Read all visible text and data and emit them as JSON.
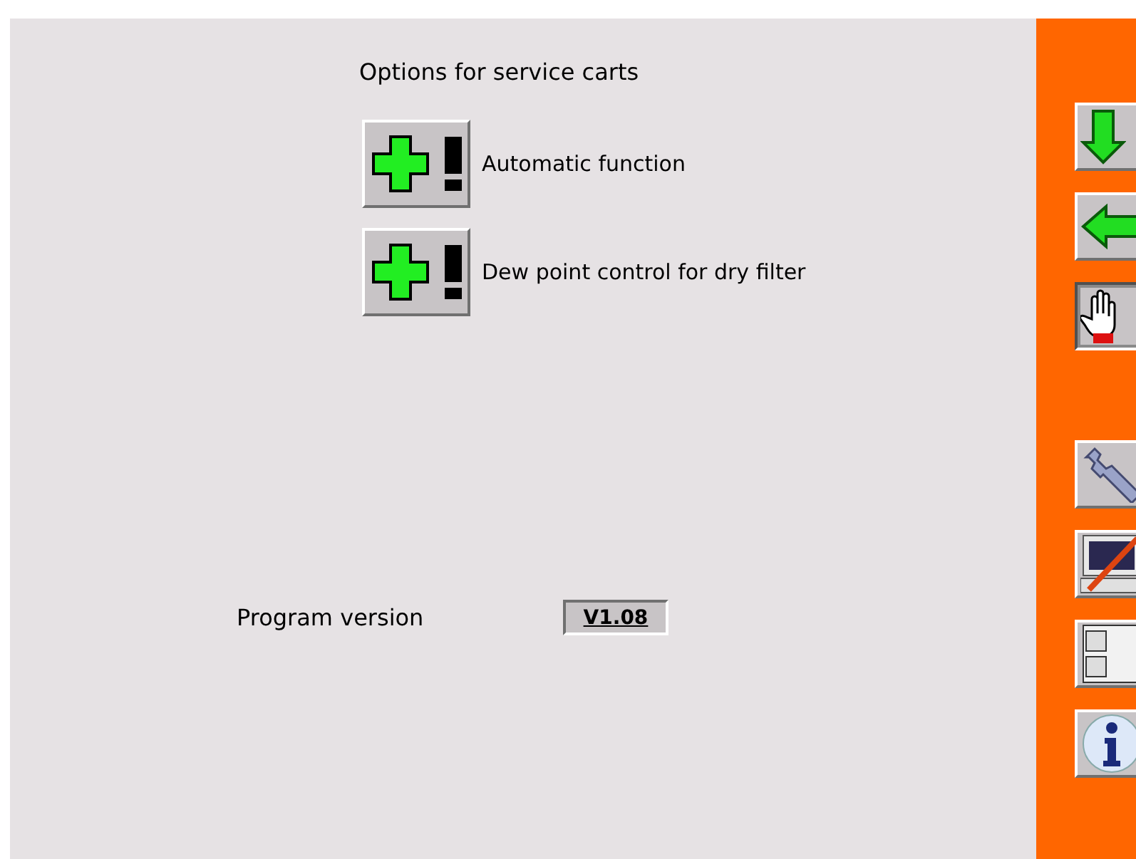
{
  "title": "Options for service carts",
  "options": [
    {
      "label": "Automatic function"
    },
    {
      "label": "Dew point control for dry filter"
    }
  ],
  "version": {
    "label": "Program version",
    "value": "V1.08"
  },
  "sidebar": {
    "top": [
      {
        "kind": "down-arrow",
        "selected": false
      },
      {
        "kind": "left-arrow",
        "selected": false
      },
      {
        "kind": "hand",
        "selected": true
      }
    ],
    "bottom": [
      {
        "kind": "wrench",
        "selected": false
      },
      {
        "kind": "computer",
        "selected": false
      },
      {
        "kind": "cabinet",
        "selected": false
      },
      {
        "kind": "info",
        "selected": false
      }
    ]
  }
}
